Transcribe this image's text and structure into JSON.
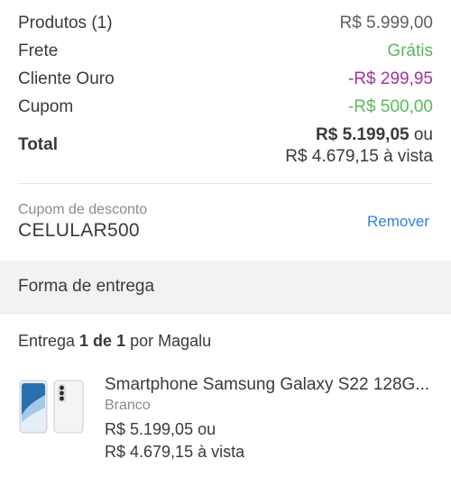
{
  "summary": {
    "products": {
      "label": "Produtos (1)",
      "value": "R$ 5.999,00"
    },
    "shipping": {
      "label": "Frete",
      "value": "Grátis"
    },
    "gold": {
      "label": "Cliente Ouro",
      "value": "-R$ 299,95"
    },
    "coupon": {
      "label": "Cupom",
      "value": "-R$ 500,00"
    },
    "total": {
      "label": "Total",
      "line1_strong": "R$ 5.199,05",
      "line1_suffix": " ou",
      "line2": "R$ 4.679,15 à vista"
    }
  },
  "coupon_box": {
    "caption": "Cupom de desconto",
    "code": "CELULAR500",
    "remove_label": "Remover"
  },
  "section": {
    "title": "Forma de entrega"
  },
  "delivery": {
    "prefix": "Entrega ",
    "count": "1 de 1",
    "suffix": " por Magalu",
    "product": {
      "name": "Smartphone Samsung Galaxy S22 128G...",
      "color": "Branco",
      "price_line1": "R$ 5.199,05 ou",
      "price_line2": "R$ 4.679,15 à vista"
    }
  },
  "colors": {
    "green": "#5cb85c",
    "purple": "#a0349a",
    "link": "#2f80ed",
    "band": "#f2f2f2"
  }
}
